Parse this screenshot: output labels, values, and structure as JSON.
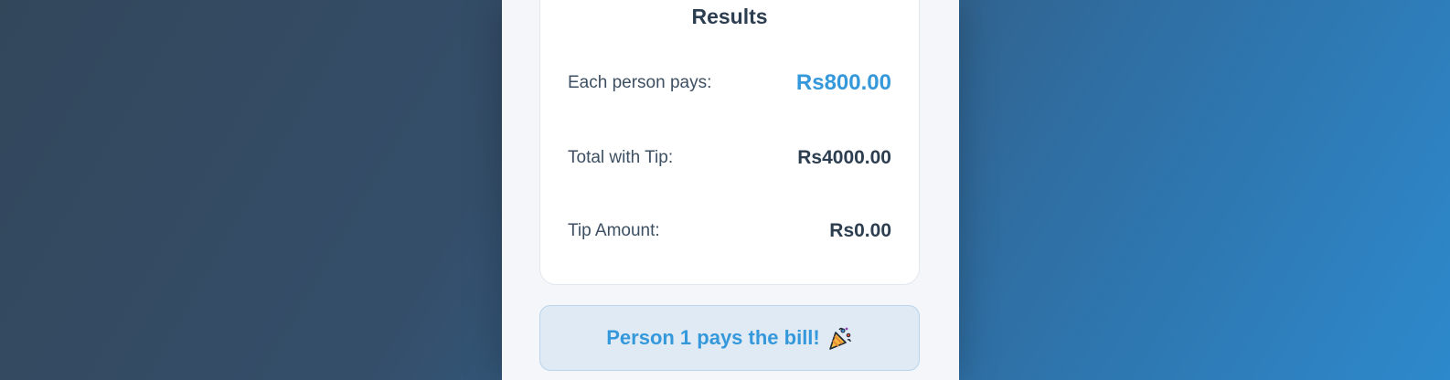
{
  "results": {
    "title": "Results",
    "rows": [
      {
        "label": "Each person pays:",
        "value": "Rs800.00"
      },
      {
        "label": "Total with Tip:",
        "value": "Rs4000.00"
      },
      {
        "label": "Tip Amount:",
        "value": "Rs0.00"
      }
    ]
  },
  "banner": {
    "text": "Person 1 pays the bill!",
    "icon": "party-popper-icon"
  },
  "colors": {
    "accent": "#3498db",
    "text_dark": "#2c3e50",
    "banner_bg": "#dfeaf5"
  }
}
